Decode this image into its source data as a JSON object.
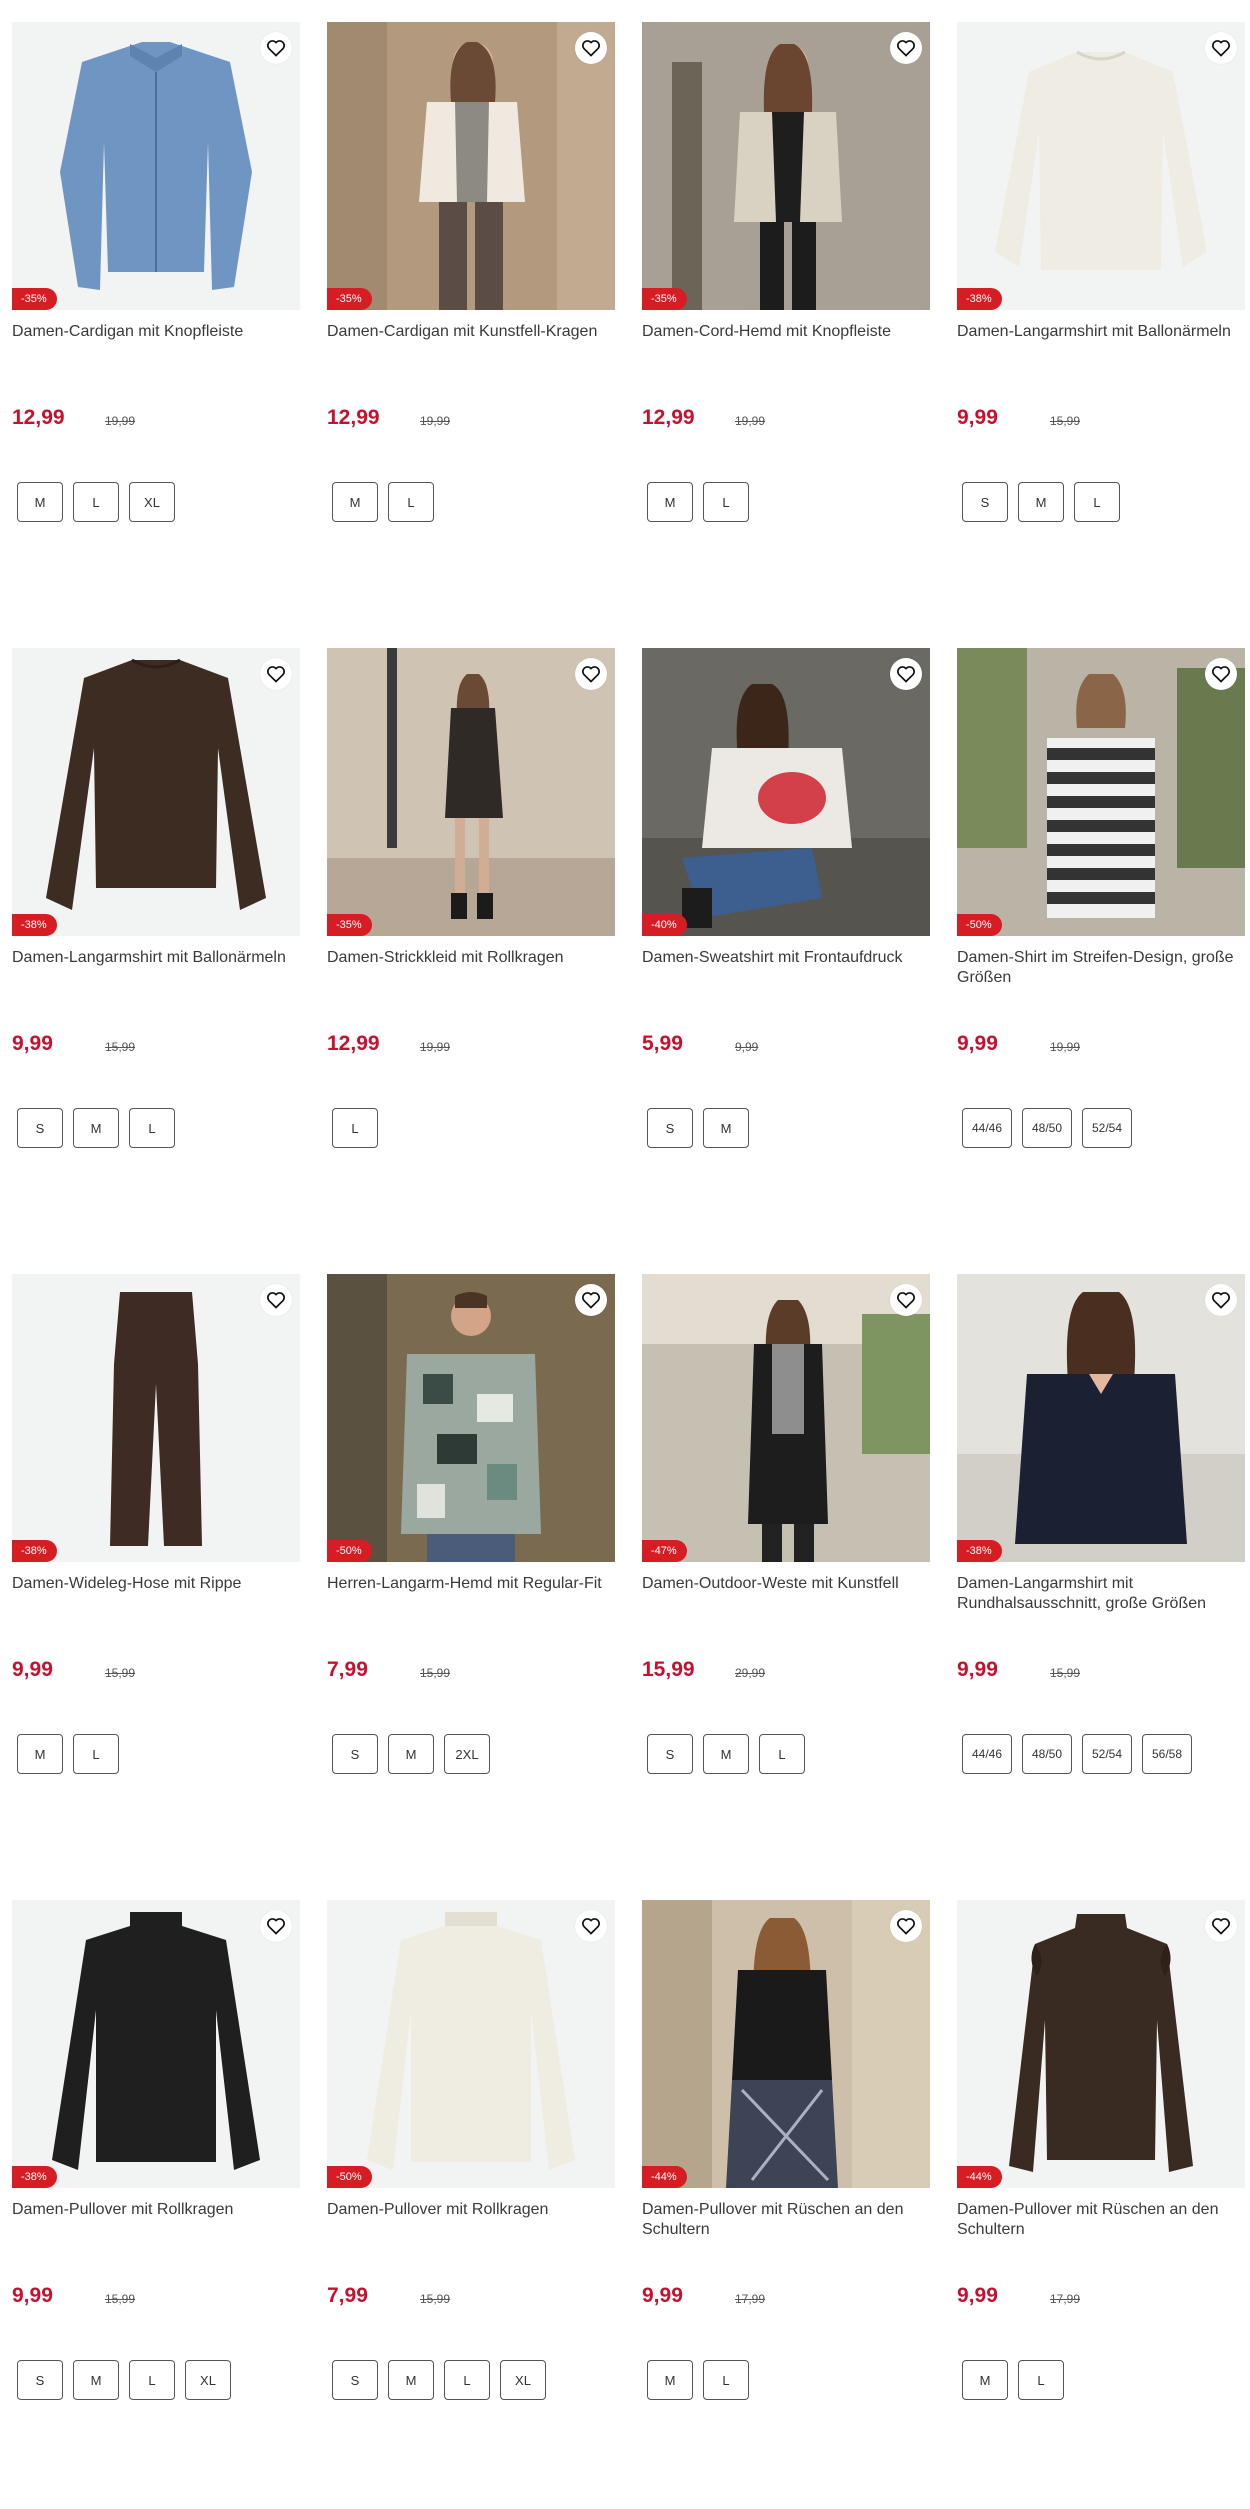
{
  "colors": {
    "price": "#c8102e",
    "badge": "#d61d23",
    "image_bg": "#f2f3f3"
  },
  "products": [
    {
      "title": "Damen-Cardigan mit Knopfleiste",
      "badge": "-35%",
      "price": "12,99",
      "old_price": "19,99",
      "sizes": [
        "M",
        "L",
        "XL"
      ],
      "image": "blue-cardigan",
      "favorite_icon": "heart-icon"
    },
    {
      "title": "Damen-Cardigan mit Kunstfell-Kragen",
      "badge": "-35%",
      "price": "12,99",
      "old_price": "19,99",
      "sizes": [
        "M",
        "L"
      ],
      "image": "woman-cream-fur-cardigan",
      "favorite_icon": "heart-icon"
    },
    {
      "title": "Damen-Cord-Hemd mit Knopfleiste",
      "badge": "-35%",
      "price": "12,99",
      "old_price": "19,99",
      "sizes": [
        "M",
        "L"
      ],
      "image": "woman-beige-cord-shirt",
      "favorite_icon": "heart-icon"
    },
    {
      "title": "Damen-Langarmshirt mit Ballonärmeln",
      "badge": "-38%",
      "price": "9,99",
      "old_price": "15,99",
      "sizes": [
        "S",
        "M",
        "L"
      ],
      "image": "cream-sweater",
      "favorite_icon": "heart-icon"
    },
    {
      "title": "Damen-Langarmshirt mit Ballonärmeln",
      "badge": "-38%",
      "price": "9,99",
      "old_price": "15,99",
      "sizes": [
        "S",
        "M",
        "L"
      ],
      "image": "brown-sweater",
      "favorite_icon": "heart-icon"
    },
    {
      "title": "Damen-Strickkleid mit Rollkragen",
      "badge": "-35%",
      "price": "12,99",
      "old_price": "19,99",
      "sizes": [
        "L"
      ],
      "image": "woman-knit-dress",
      "favorite_icon": "heart-icon"
    },
    {
      "title": "Damen-Sweatshirt mit Frontaufdruck",
      "badge": "-40%",
      "price": "5,99",
      "old_price": "9,99",
      "sizes": [
        "S",
        "M"
      ],
      "image": "woman-print-sweatshirt",
      "favorite_icon": "heart-icon"
    },
    {
      "title": "Damen-Shirt im Streifen-Design, große Größen",
      "badge": "-50%",
      "price": "9,99",
      "old_price": "19,99",
      "sizes": [
        "44/46",
        "48/50",
        "52/54"
      ],
      "image": "woman-striped-shirt",
      "favorite_icon": "heart-icon"
    },
    {
      "title": "Damen-Wideleg-Hose mit Rippe",
      "badge": "-38%",
      "price": "9,99",
      "old_price": "15,99",
      "sizes": [
        "M",
        "L"
      ],
      "image": "brown-pants",
      "favorite_icon": "heart-icon"
    },
    {
      "title": "Herren-Langarm-Hemd mit Regular-Fit",
      "badge": "-50%",
      "price": "7,99",
      "old_price": "15,99",
      "sizes": [
        "S",
        "M",
        "2XL"
      ],
      "image": "man-patterned-shirt",
      "favorite_icon": "heart-icon"
    },
    {
      "title": "Damen-Outdoor-Weste mit Kunstfell",
      "badge": "-47%",
      "price": "15,99",
      "old_price": "29,99",
      "sizes": [
        "S",
        "M",
        "L"
      ],
      "image": "woman-black-vest",
      "favorite_icon": "heart-icon"
    },
    {
      "title": "Damen-Langarmshirt mit Rundhalsausschnitt, große Größen",
      "badge": "-38%",
      "price": "9,99",
      "old_price": "15,99",
      "sizes": [
        "44/46",
        "48/50",
        "52/54",
        "56/58"
      ],
      "image": "woman-navy-blouse",
      "favorite_icon": "heart-icon"
    },
    {
      "title": "Damen-Pullover mit Rollkragen",
      "badge": "-38%",
      "price": "9,99",
      "old_price": "15,99",
      "sizes": [
        "S",
        "M",
        "L",
        "XL"
      ],
      "image": "black-turtleneck",
      "favorite_icon": "heart-icon"
    },
    {
      "title": "Damen-Pullover mit Rollkragen",
      "badge": "-50%",
      "price": "7,99",
      "old_price": "15,99",
      "sizes": [
        "S",
        "M",
        "L",
        "XL"
      ],
      "image": "cream-turtleneck",
      "favorite_icon": "heart-icon"
    },
    {
      "title": "Damen-Pullover mit Rüschen an den Schultern",
      "badge": "-44%",
      "price": "9,99",
      "old_price": "17,99",
      "sizes": [
        "M",
        "L"
      ],
      "image": "woman-black-ruffle-pullover",
      "favorite_icon": "heart-icon"
    },
    {
      "title": "Damen-Pullover mit Rüschen an den Schultern",
      "badge": "-44%",
      "price": "9,99",
      "old_price": "17,99",
      "sizes": [
        "M",
        "L"
      ],
      "image": "brown-ruffle-pullover",
      "favorite_icon": "heart-icon"
    }
  ]
}
